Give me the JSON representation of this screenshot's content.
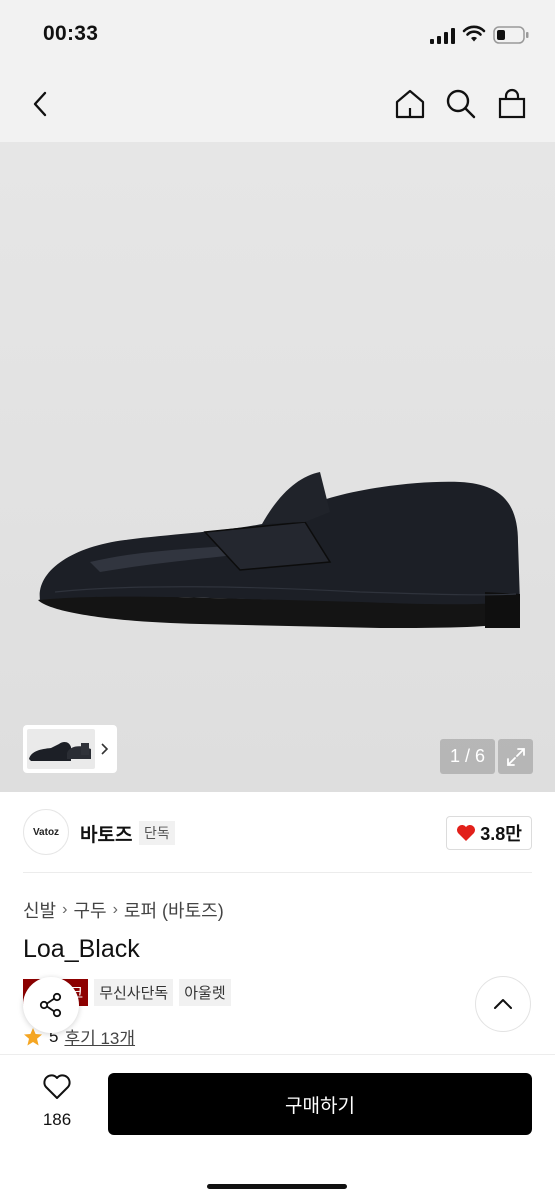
{
  "status": {
    "time": "00:33"
  },
  "nav": {
    "back": "back-icon",
    "home": "home-icon",
    "search": "search-icon",
    "cart": "shopping-bag-icon"
  },
  "gallery": {
    "counter": "1 / 6",
    "current": 1,
    "total": 6
  },
  "brand": {
    "logo_text": "Vatoz",
    "name": "바토즈",
    "tag": "단독",
    "likes": "3.8만"
  },
  "breadcrumb": [
    "신발",
    "구두",
    "로퍼 (바토즈)"
  ],
  "product": {
    "name": "Loa_Black"
  },
  "tags": [
    "컴스위크",
    "무신사단독",
    "아울렛"
  ],
  "rating": {
    "score": "5",
    "reviews": "후기 13개"
  },
  "bottom": {
    "wish_count": "186",
    "buy_label": "구매하기"
  },
  "colors": {
    "accent_red": "#8e0000",
    "heart": "#e2201a",
    "star": "#f5a623",
    "buy_button": "#000000"
  }
}
